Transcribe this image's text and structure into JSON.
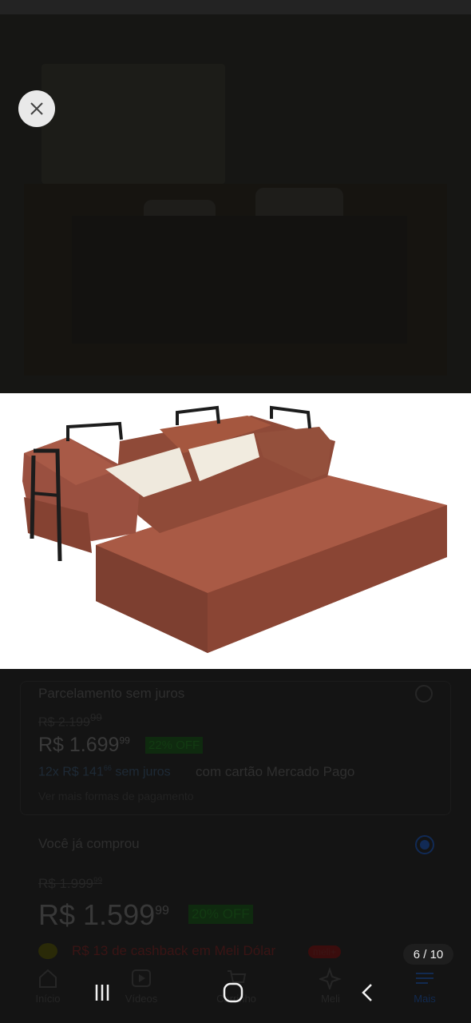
{
  "viewer": {
    "counter": "6 / 10",
    "close_icon": "close-icon"
  },
  "product_photo": {
    "sofa_color": "#9a4f3a",
    "pillow_color": "#f1ede2",
    "frame_color": "#1c1c1c"
  },
  "page": {
    "installment_label": "Parcelamento sem juros",
    "old_price_1": "R$ 2.199",
    "old_price_1_cents": "99",
    "price_1": "R$ 1.699",
    "price_1_cents": "99",
    "discount_1": "22% OFF",
    "installments_1": "12x R$ 141",
    "installments_1_cents": "66",
    "installments_1_suffix": "sem juros",
    "installments_1_card": "com cartão Mercado Pago",
    "verify_link": "Ver mais formas de pagamento",
    "bought_label": "Você já comprou",
    "old_price_2": "R$ 1.999",
    "old_price_2_cents": "99",
    "price_2": "R$ 1.599",
    "price_2_cents": "99",
    "discount_2": "20% OFF",
    "cashback": "R$ 13 de cashback em Meli Dólar",
    "cashback_badge": "meli+"
  },
  "tabbar": {
    "inicio": "Início",
    "videos": "Vídeos",
    "carrinho": "Carrinho",
    "meli": "Meli",
    "mais": "Mais"
  },
  "accent_colors": {
    "brand_blue": "#3483fa",
    "discount_green": "#00a650"
  }
}
